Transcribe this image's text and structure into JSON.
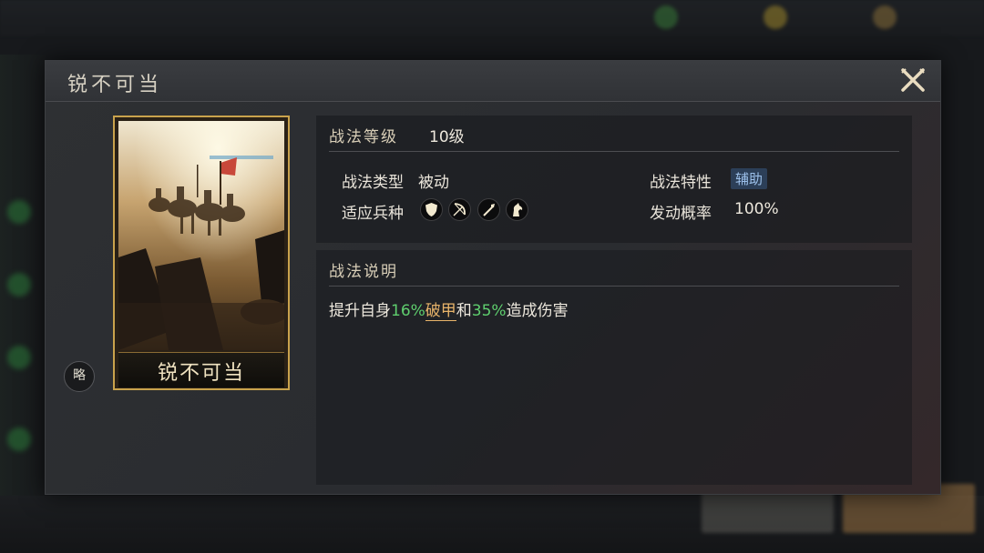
{
  "dialog": {
    "title": "锐不可当"
  },
  "card": {
    "name": "锐不可当",
    "side_badge": "略"
  },
  "tactic": {
    "level_label": "战法等级",
    "level_value": "10级",
    "type_label": "战法类型",
    "type_value": "被动",
    "trait_label": "战法特性",
    "trait_value": "辅助",
    "troops_label": "适应兵种",
    "troops": [
      "shield-icon",
      "bow-icon",
      "spear-icon",
      "horse-icon"
    ],
    "chance_label": "发动概率",
    "chance_value": "100%"
  },
  "description": {
    "header": "战法说明",
    "part1": "提升自身",
    "val1": "16%",
    "keyword": "破甲",
    "part2": "和",
    "val2": "35%",
    "part3": "造成伤害"
  },
  "colors": {
    "accent_gold": "#c9a24c",
    "highlight_green": "#5fcf6e",
    "highlight_orange": "#e8b46a",
    "tag_blue": "#9cc0ea"
  }
}
